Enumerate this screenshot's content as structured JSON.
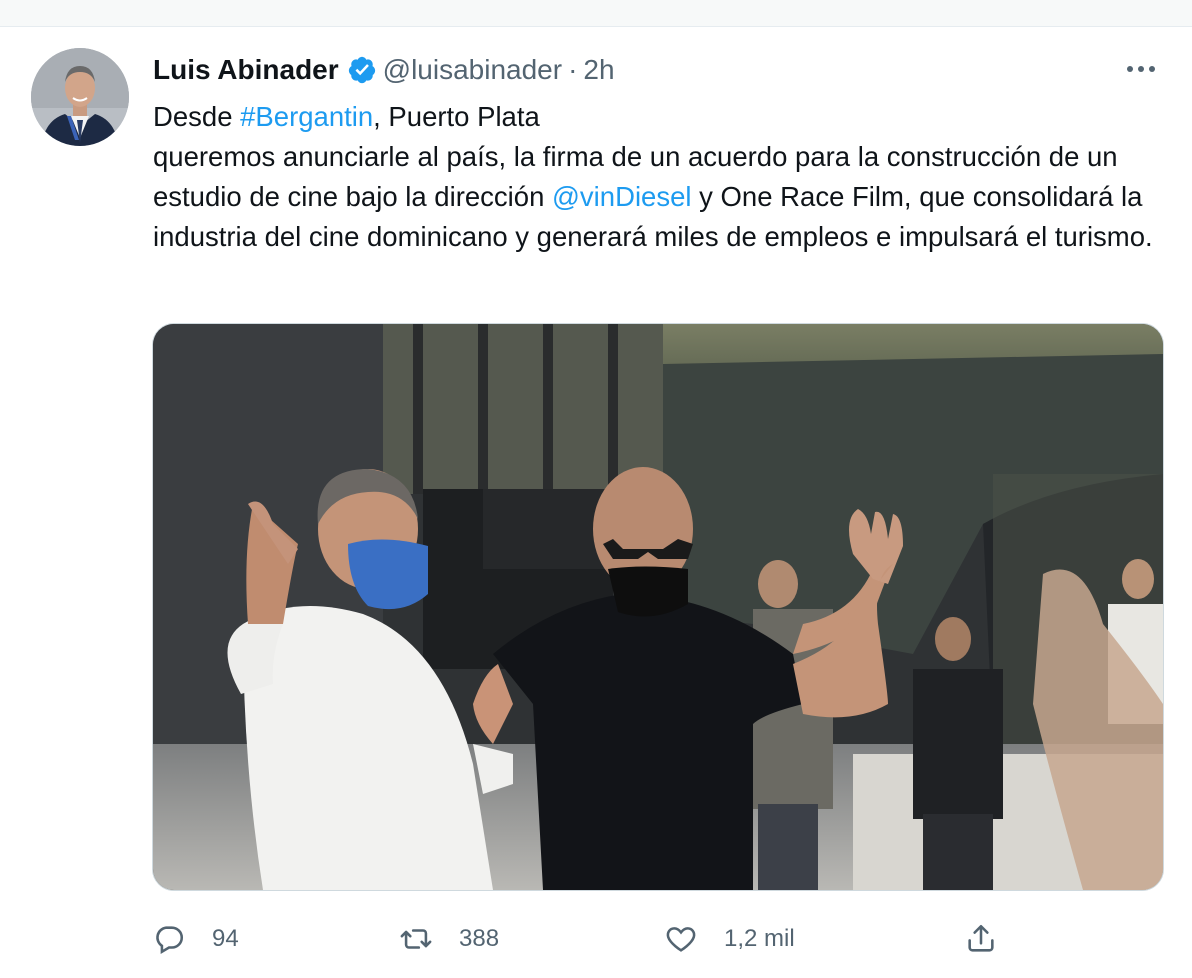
{
  "tweet": {
    "author_name": "Luis Abinader",
    "handle": "@luisabinader",
    "separator": "·",
    "time": "2h",
    "text": {
      "p1": "Desde ",
      "hashtag": "#Bergantin",
      "p2": ", Puerto Plata",
      "p3": "queremos anunciarle al país, la firma de un acuerdo para la construcción de un estudio de cine bajo la dirección ",
      "mention": "@vinDiesel",
      "p4": " y One Race Film, que consolidará la industria del cine dominicano y generará miles de empleos e impulsará el turismo."
    }
  },
  "actions": {
    "reply_count": "94",
    "retweet_count": "388",
    "like_count": "1,2 mil"
  },
  "icons": {
    "verified": "verified-badge-icon",
    "more": "more-options-icon",
    "reply": "reply-icon",
    "retweet": "retweet-icon",
    "like": "heart-icon",
    "share": "share-icon"
  },
  "colors": {
    "link": "#1d9bf0",
    "secondary_text": "#536471",
    "primary_text": "#0f1419"
  }
}
